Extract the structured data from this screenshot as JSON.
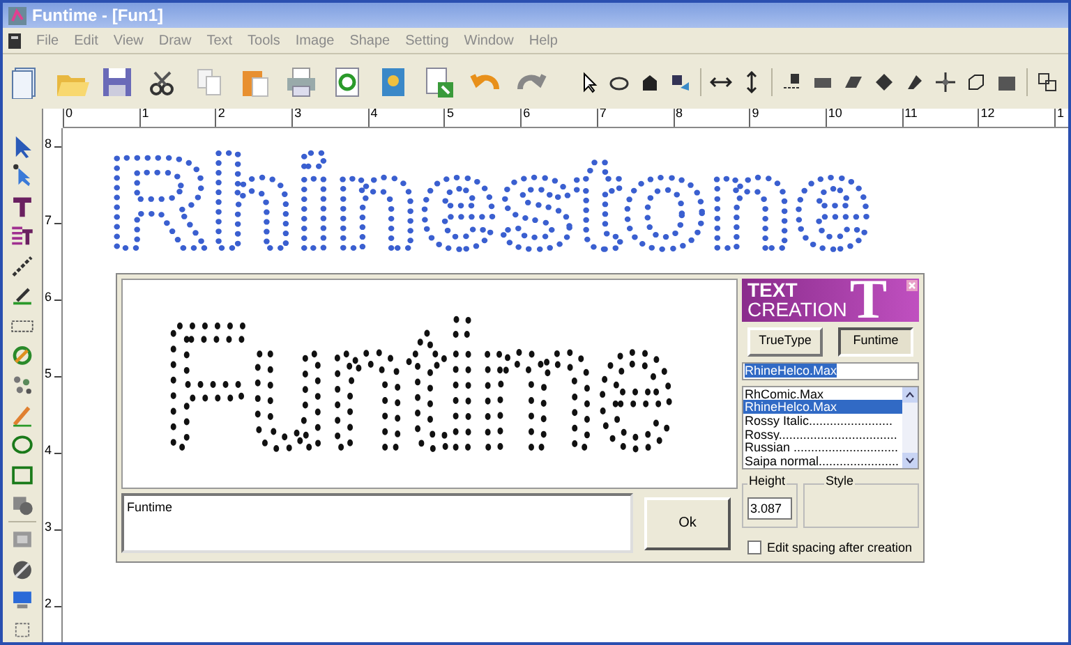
{
  "window": {
    "title": "Funtime - [Fun1]"
  },
  "menu": [
    "File",
    "Edit",
    "View",
    "Draw",
    "Text",
    "Tools",
    "Image",
    "Shape",
    "Setting",
    "Window",
    "Help"
  ],
  "ruler_horizontal": [
    "0",
    "1",
    "2",
    "3",
    "4",
    "5",
    "6",
    "7",
    "8",
    "9",
    "10",
    "11",
    "12",
    "1"
  ],
  "ruler_vertical": [
    "8",
    "7",
    "6",
    "5",
    "4",
    "3",
    "2"
  ],
  "canvas": {
    "text": "Rhinestone"
  },
  "text_creation": {
    "logo_lines": [
      "TEXT",
      "CREATION"
    ],
    "logo_letter": "T",
    "buttons": [
      {
        "label": "TrueType",
        "selected": false
      },
      {
        "label": "Funtime",
        "selected": true
      }
    ],
    "font_field": "RhineHelco.Max",
    "fonts": [
      {
        "label": "RhComic.Max",
        "selected": false
      },
      {
        "label": "RhineHelco.Max",
        "selected": true
      },
      {
        "label": "Rossy Italic........................",
        "selected": false
      },
      {
        "label": "Rossy..................................",
        "selected": false
      },
      {
        "label": "Russian ..............................",
        "selected": false
      },
      {
        "label": "Saipa normal.......................",
        "selected": false
      }
    ],
    "preview_text": "Funtime",
    "text_input": "Funtime",
    "ok_label": "Ok",
    "height_label": "Height",
    "height_value": "3.087",
    "style_label": "Style",
    "edit_spacing": {
      "label": "Edit spacing after creation",
      "checked": false
    }
  }
}
